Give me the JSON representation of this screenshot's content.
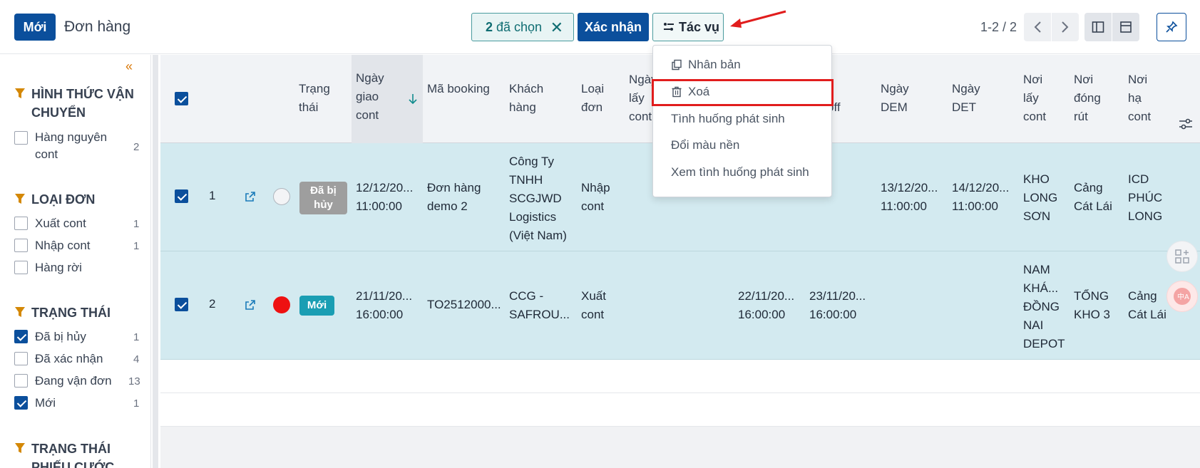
{
  "header": {
    "new_label": "Mới",
    "title": "Đơn hàng",
    "selected_count": "2",
    "selected_text": "đã chọn",
    "confirm_label": "Xác nhận",
    "actions_label": "Tác vụ",
    "pager": "1-2 / 2"
  },
  "dropdown": {
    "items": [
      {
        "label": "Nhân bản",
        "icon": "copy-icon"
      },
      {
        "label": "Xoá",
        "icon": "trash-icon"
      },
      {
        "label": "Tình huống phát sinh"
      },
      {
        "label": "Đổi màu nền"
      },
      {
        "label": "Xem tình huống phát sinh"
      }
    ]
  },
  "sidebar": {
    "groups": [
      {
        "title": "HÌNH THỨC VẬN CHUYỂN",
        "items": [
          {
            "label": "Hàng nguyên cont",
            "count": "2",
            "checked": false
          }
        ]
      },
      {
        "title": "LOẠI ĐƠN",
        "items": [
          {
            "label": "Xuất cont",
            "count": "1",
            "checked": false
          },
          {
            "label": "Nhập cont",
            "count": "1",
            "checked": false
          },
          {
            "label": "Hàng rời",
            "count": "",
            "checked": false
          }
        ]
      },
      {
        "title": "TRẠNG THÁI",
        "items": [
          {
            "label": "Đã bị hủy",
            "count": "1",
            "checked": true
          },
          {
            "label": "Đã xác nhận",
            "count": "4",
            "checked": false
          },
          {
            "label": "Đang vận đơn",
            "count": "13",
            "checked": false
          },
          {
            "label": "Mới",
            "count": "1",
            "checked": true
          }
        ]
      },
      {
        "title": "TRẠNG THÁI PHIẾU CƯỚC",
        "items": []
      }
    ]
  },
  "table": {
    "columns": {
      "status": "Trạng thái",
      "delivery_date": "Ngày giao cont",
      "booking": "Mã booking",
      "customer": "Khách hàng",
      "order_type": "Loại đơn",
      "pickup_date": "Ngày lấy cont",
      "cutoff": "off",
      "dem": "Ngày DEM",
      "det": "Ngày DET",
      "pickup_place": "Nơi lấy cont",
      "unload_place": "Nơi đóng rút",
      "drop_place": "Nơi hạ cont"
    },
    "rows": [
      {
        "index": "1",
        "status": "Đã bị hủy",
        "delivery_date": "12/12/20...",
        "delivery_time": "11:00:00",
        "booking": "Đơn hàng demo 2",
        "customer": "Công Ty TNHH SCGJWD Logistics (Việt Nam)",
        "order_type": "Nhập cont",
        "d1": "",
        "t1": "",
        "d2": "",
        "t2": "",
        "dem": "13/12/20...",
        "dem_time": "11:00:00",
        "det": "14/12/20...",
        "det_time": "11:00:00",
        "pickup_place": "KHO LONG SƠN",
        "unload_place": "Cảng Cát Lái",
        "drop_place": "ICD PHÚC LONG"
      },
      {
        "index": "2",
        "status": "Mới",
        "delivery_date": "21/11/20...",
        "delivery_time": "16:00:00",
        "booking": "TO2512000...",
        "customer": "CCG - SAFROU...",
        "order_type": "Xuất cont",
        "d1": "22/11/20...",
        "t1": "16:00:00",
        "d2": "23/11/20...",
        "t2": "16:00:00",
        "dem": "",
        "dem_time": "",
        "det": "",
        "det_time": "",
        "pickup_place": "NAM KHÁ... ĐỒNG NAI DEPOT",
        "unload_place": "TỔNG KHO 3",
        "drop_place": "Cảng Cát Lái"
      }
    ]
  },
  "colors": {
    "primary": "#0b4f9c",
    "teal": "#0f6d72",
    "row_selected": "#d3eaf0",
    "cancelled_badge": "#9e9e9e",
    "new_badge": "#1a9eb3",
    "red_dot": "#ee1111",
    "highlight": "#e11d1d"
  }
}
